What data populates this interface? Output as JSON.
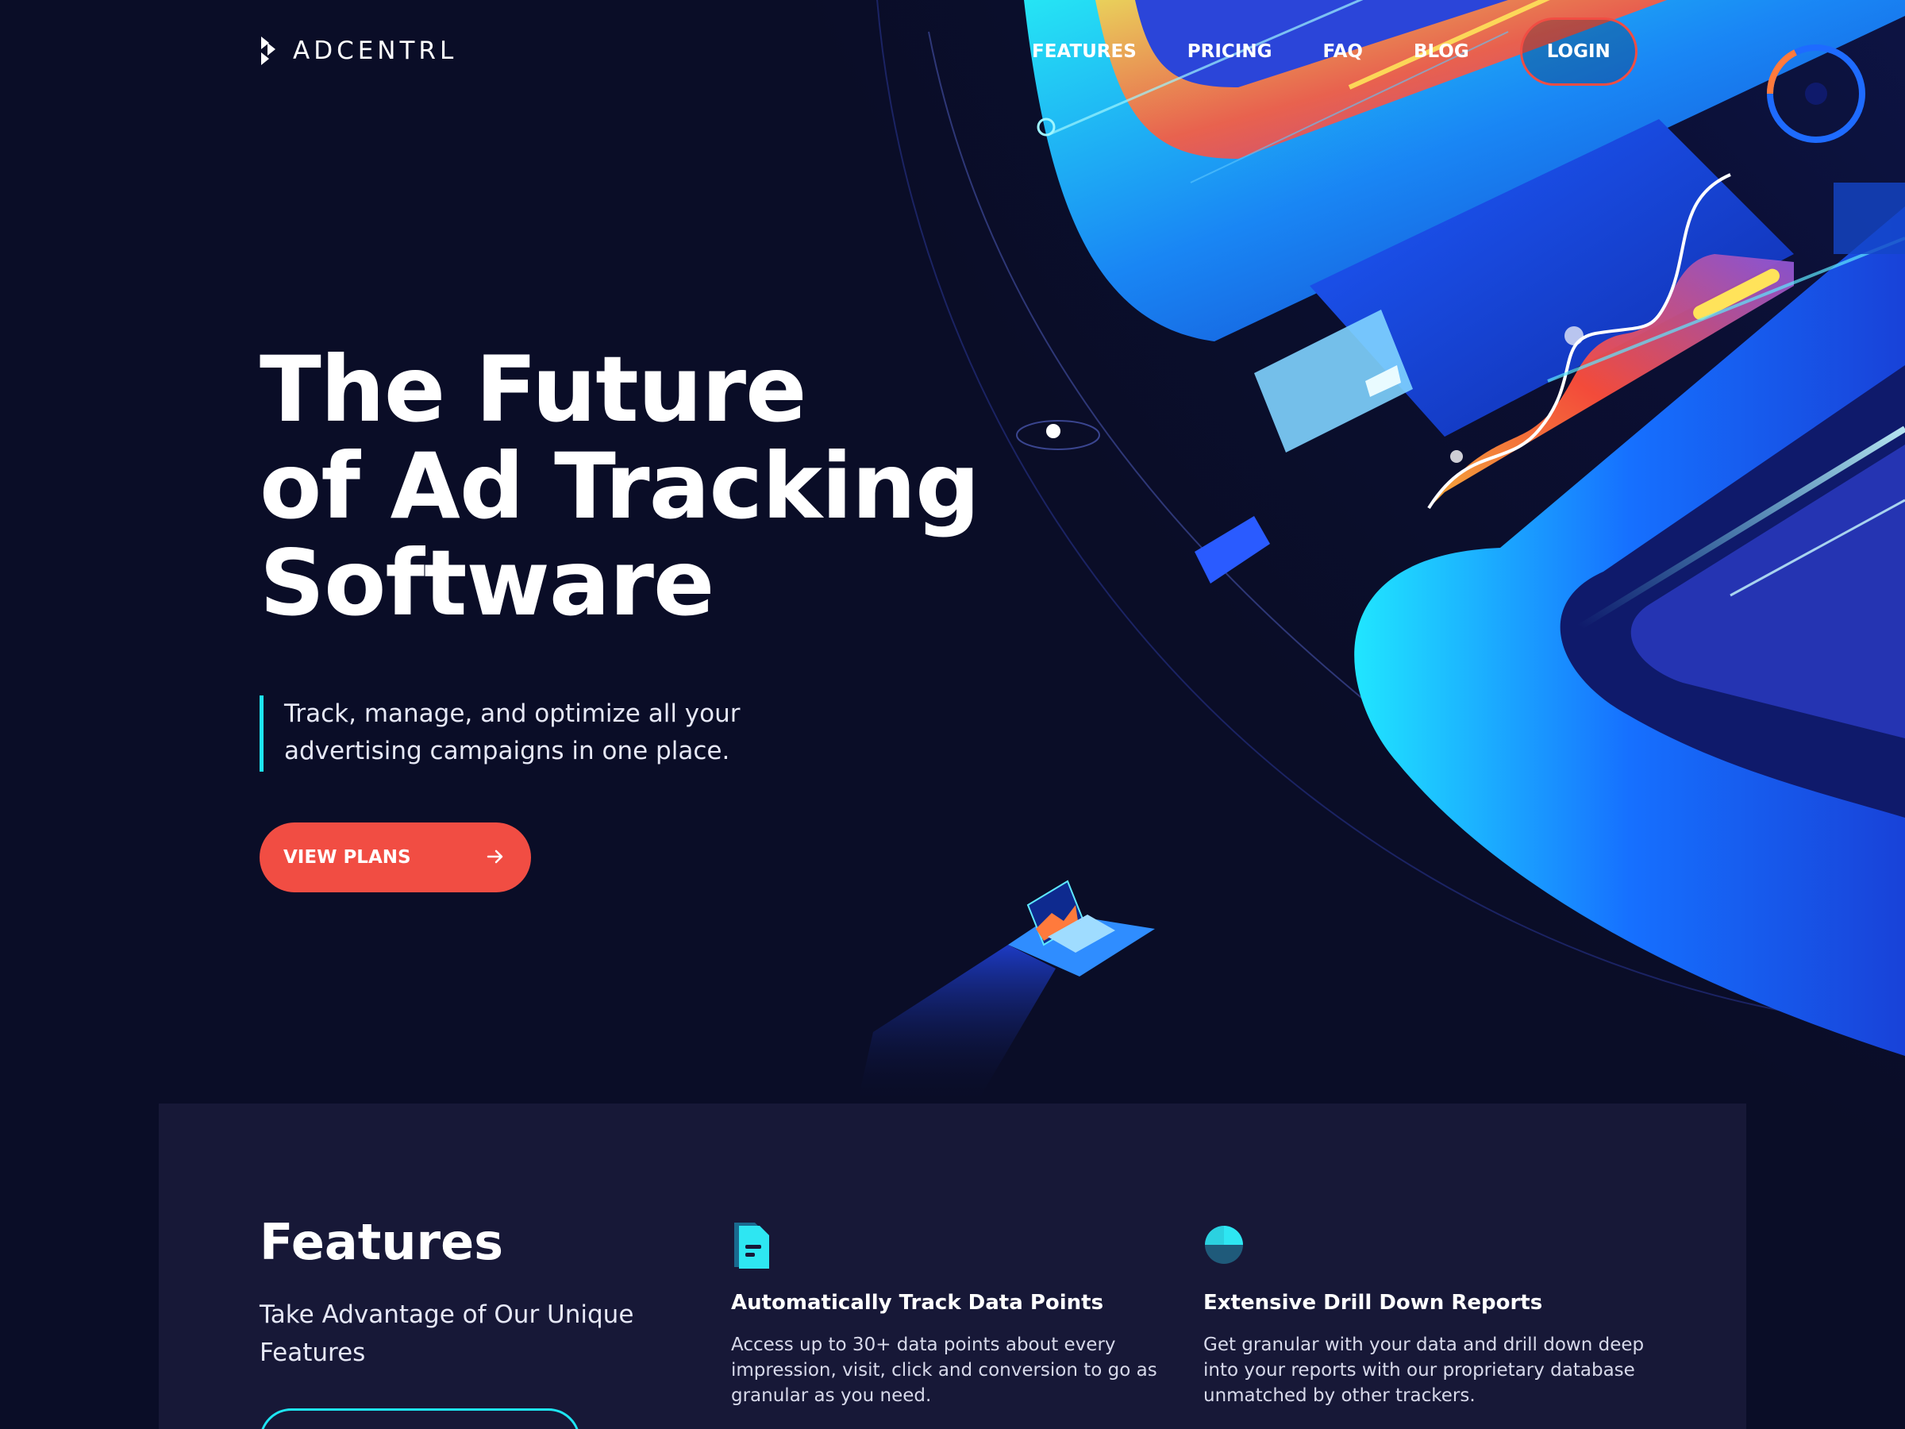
{
  "brand": {
    "name": "ADCENTRL"
  },
  "nav": {
    "links": [
      "FEATURES",
      "PRICING",
      "FAQ",
      "BLOG"
    ],
    "login_label": "LOGIN"
  },
  "hero": {
    "title_lines": [
      "The Future",
      "of Ad Tracking",
      "Software"
    ],
    "tagline_lines": [
      "Track, manage, and optimize all your",
      "advertising campaigns in one place."
    ],
    "cta_label": "VIEW PLANS"
  },
  "features": {
    "title": "Features",
    "subtitle_lines": [
      "Take Advantage of Our Unique",
      "Features"
    ],
    "items": [
      {
        "icon": "document-icon",
        "title": "Automatically Track Data Points",
        "desc_lines": [
          "Access up to 30+ data points about every",
          "impression, visit, click and conversion to go as",
          "granular as you need."
        ]
      },
      {
        "icon": "pie-chart-icon",
        "title": "Extensive Drill Down Reports",
        "desc_lines": [
          "Get granular with your data and drill down deep",
          "into your reports with our proprietary database",
          "unmatched by other trackers."
        ]
      }
    ]
  },
  "colors": {
    "background": "#0a0d27",
    "accent_red": "#f14d43",
    "accent_cyan": "#1ee5f2",
    "panel": "#171837"
  }
}
